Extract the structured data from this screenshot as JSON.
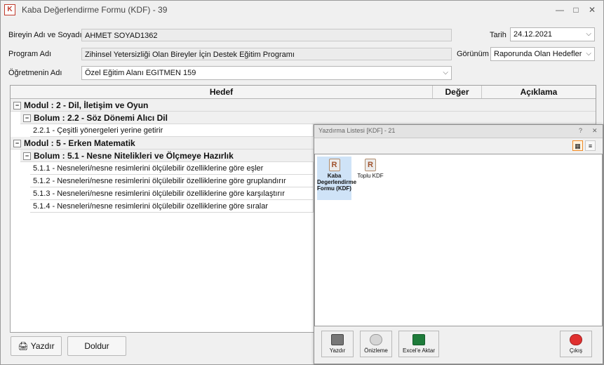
{
  "window": {
    "title": "Kaba Değerlendirme Formu (KDF) - 39",
    "minimize": "—",
    "maximize": "□",
    "close": "✕"
  },
  "form": {
    "bireyin_label": "Bireyin Adı ve Soyadı",
    "bireyin_value": "AHMET SOYAD1362",
    "program_label": "Program Adı",
    "program_value": "Zihinsel Yetersizliği Olan Bireyler İçin Destek Eğitim Programı",
    "ogretmen_label": "Öğretmenin Adı",
    "ogretmen_value": "Özel Eğitim Alanı EGITMEN 159",
    "tarih_label": "Tarih",
    "tarih_value": "24.12.2021",
    "gorunum_label": "Görünüm",
    "gorunum_value": "Raporunda Olan Hedefler"
  },
  "grid": {
    "headers": [
      "Hedef",
      "Değer",
      "Açıklama"
    ],
    "modul1": "Modul : 2 - Dil, İletişim ve Oyun",
    "bolum1": "Bolum : 2.2 - Söz Dönemi Alıcı Dil",
    "items1": [
      "2.2.1 - Çeşitli yönergeleri yerine getirir"
    ],
    "modul2": "Modul : 5 - Erken Matematik",
    "bolum2": "Bolum : 5.1 - Nesne Nitelikleri ve Ölçmeye Hazırlık",
    "items2": [
      "5.1.1 - Nesneleri/nesne resimlerini ölçülebilir özelliklerine göre eşler",
      "5.1.2 - Nesneleri/nesne resimlerini ölçülebilir özelliklerine göre gruplandırır",
      "5.1.3 - Nesneleri/nesne resimlerini ölçülebilir özelliklerine göre karşılaştırır",
      "5.1.4 - Nesneleri/nesne resimlerini ölçülebilir özelliklerine göre sıralar"
    ]
  },
  "buttons": {
    "yazdir": "Yazdır",
    "doldur": "Doldur"
  },
  "dialog": {
    "title": "Yazdırma Listesi [KDF] - 21",
    "help": "?",
    "close": "✕",
    "tile1": "Kaba Degerlendirme Formu (KDF)",
    "tile2": "Toplu KDF",
    "btn_yazdir": "Yazdır",
    "btn_onizleme": "Önizleme",
    "btn_excel": "Excel'e Aktar",
    "btn_cikis": "Çıkış"
  }
}
